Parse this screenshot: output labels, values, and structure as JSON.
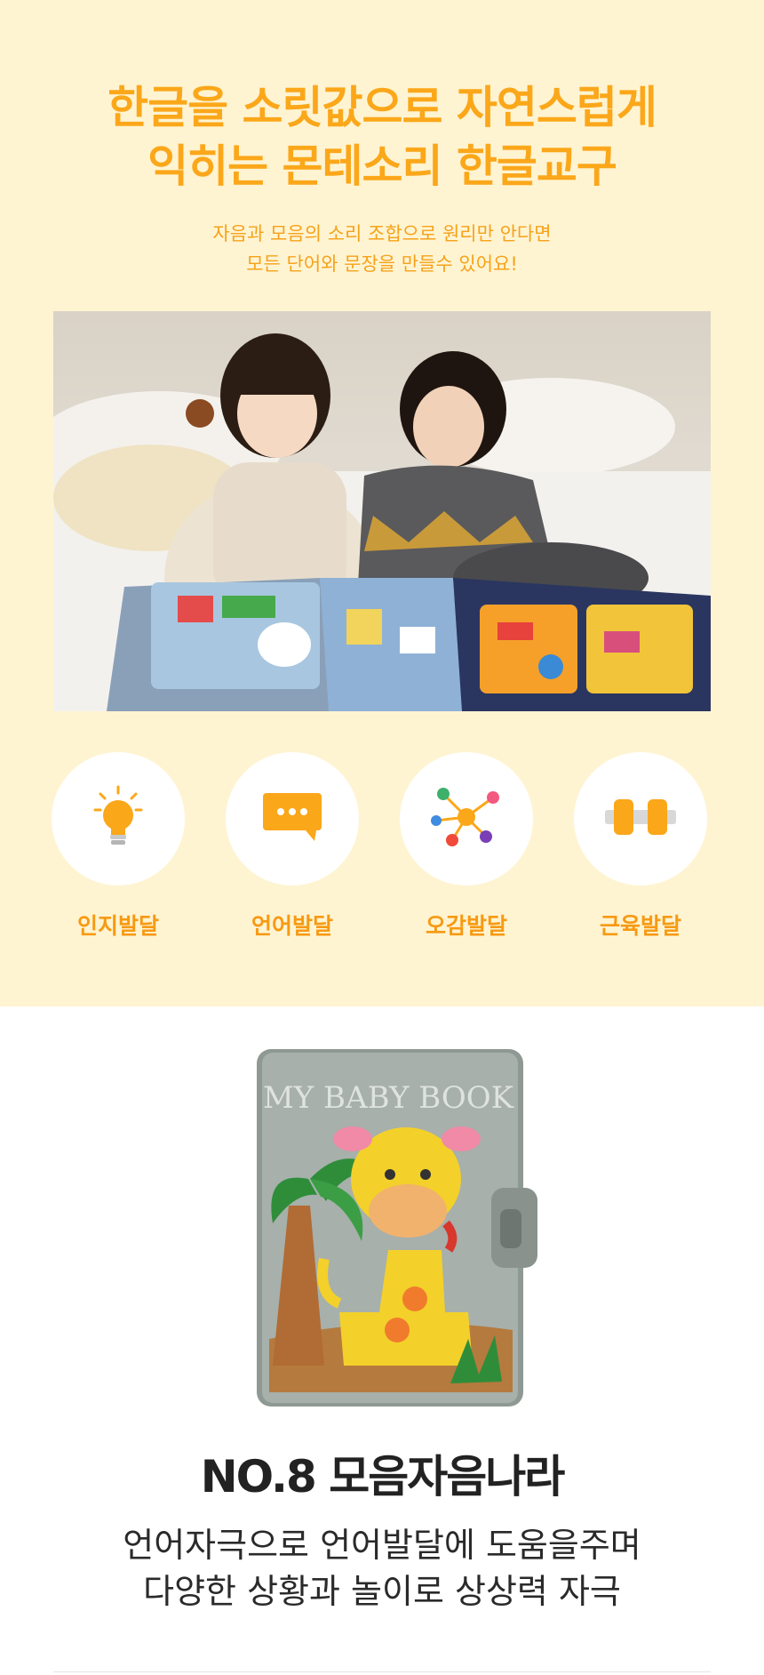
{
  "hero": {
    "headline_line1": "한글을 소릿값으로 자연스럽게",
    "headline_line2": "익히는 몬테소리 한글교구",
    "sub_line1": "자음과 모음의 소리 조합으로 원리만 안다면",
    "sub_line2": "모든 단어와 문장을 만들수 있어요!"
  },
  "features": [
    {
      "label": "인지발달",
      "icon": "lightbulb-icon"
    },
    {
      "label": "언어발달",
      "icon": "speech-bubble-icon"
    },
    {
      "label": "오감발달",
      "icon": "network-icon"
    },
    {
      "label": "근육발달",
      "icon": "dumbbell-icon"
    }
  ],
  "product": {
    "book_cover_text": "MY BABY BOOK",
    "title": "NO.8 모음자음나라",
    "desc_line1": "언어자극으로 언어발달에 도움을주며",
    "desc_line2": "다양한 상황과 놀이로 상상력 자극"
  },
  "colors": {
    "accent": "#fba71a",
    "top_background": "#fff4d2",
    "title_text": "#222222"
  }
}
